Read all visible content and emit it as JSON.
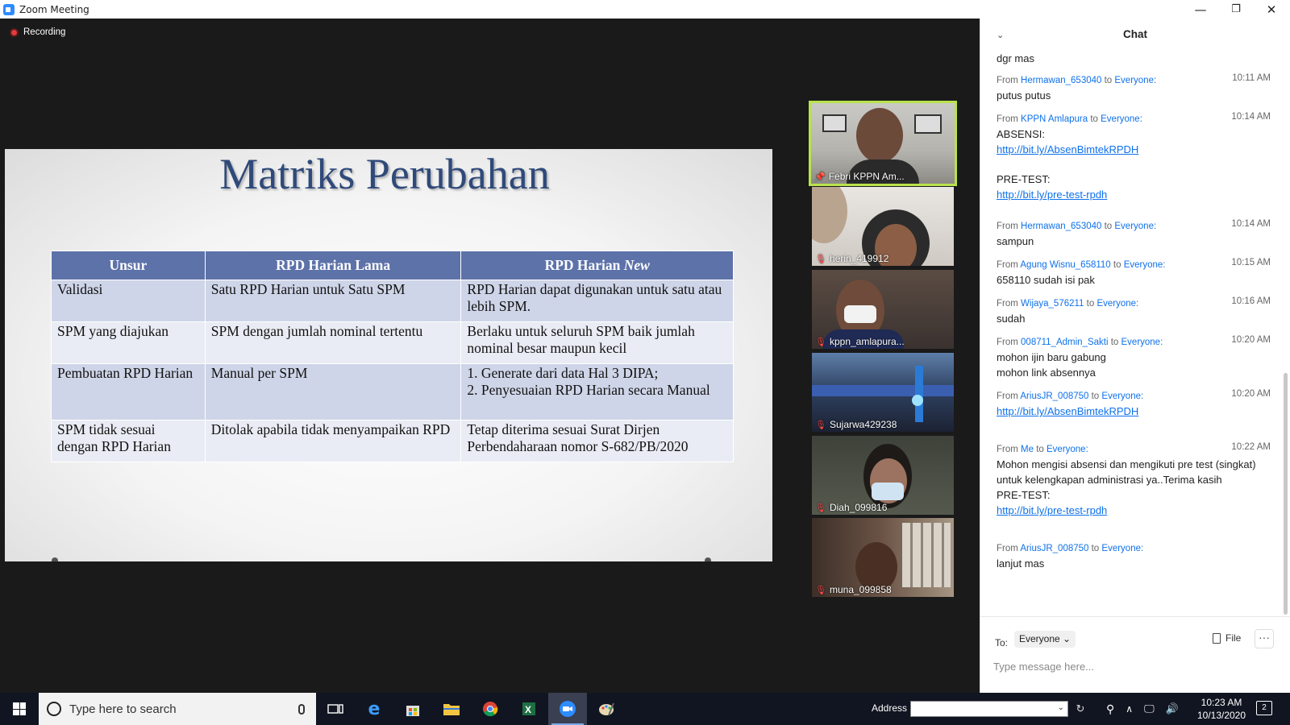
{
  "window": {
    "title": "Zoom Meeting",
    "minimize": "—",
    "maximize": "❐",
    "close": "✕"
  },
  "meeting": {
    "recording_label": "Recording"
  },
  "slide": {
    "title": "Matriks Perubahan",
    "headers": [
      "Unsur",
      "RPD Harian Lama",
      "RPD Harian ",
      "New"
    ],
    "rows": [
      [
        "Validasi",
        "Satu RPD Harian untuk Satu SPM",
        "RPD Harian dapat digunakan untuk satu atau lebih SPM."
      ],
      [
        "SPM yang diajukan",
        "SPM dengan jumlah nominal tertentu",
        "Berlaku untuk seluruh SPM baik jumlah nominal besar maupun kecil"
      ],
      [
        "Pembuatan RPD Harian",
        "Manual per SPM",
        "1. Generate dari data Hal 3 DIPA;",
        "2. Penyesuaian RPD Harian secara Manual"
      ],
      [
        "SPM tidak sesuai dengan RPD Harian",
        "Ditolak apabila tidak menyampaikan RPD",
        "Tetap diterima sesuai Surat Dirjen Perbendaharaan nomor S-682/PB/2020"
      ]
    ]
  },
  "participants": [
    {
      "name": "Febri KPPN Am...",
      "status": "pinned"
    },
    {
      "name": "herin_419912",
      "status": "muted"
    },
    {
      "name": "kppn_amlapura...",
      "status": "muted"
    },
    {
      "name": "Sujarwa429238",
      "status": "muted"
    },
    {
      "name": "Diah_099816",
      "status": "muted"
    },
    {
      "name": "muna_099858",
      "status": "muted"
    }
  ],
  "chat": {
    "header": "Chat",
    "top_fragment": "dgr mas",
    "from_word": "From ",
    "to_word": " to ",
    "messages": [
      {
        "from": "Hermawan_653040",
        "to": "Everyone:",
        "time": "10:11 AM",
        "lines": [
          "putus putus"
        ]
      },
      {
        "from": "KPPN Amlapura",
        "to": "Everyone:",
        "time": "10:14 AM",
        "lines": [
          "ABSENSI:"
        ],
        "link1": "http://bit.ly/AbsenBimtekRPDH",
        "line2": "PRE-TEST:",
        "link2": "http://bit.ly/pre-test-rpdh"
      },
      {
        "from": "Hermawan_653040",
        "to": "Everyone:",
        "time": "10:14 AM",
        "lines": [
          "sampun"
        ]
      },
      {
        "from": "Agung Wisnu_658110",
        "to": "Everyone:",
        "time": "10:15 AM",
        "lines": [
          "658110 sudah isi pak"
        ]
      },
      {
        "from": "Wijaya_576211",
        "to": "Everyone:",
        "time": "10:16 AM",
        "lines": [
          "sudah"
        ]
      },
      {
        "from": "008711_Admin_Sakti",
        "to": "Everyone:",
        "time": "10:20 AM",
        "lines": [
          "mohon ijin baru gabung",
          "mohon link absennya"
        ]
      },
      {
        "from": "AriusJR_008750",
        "to": "Everyone:",
        "time": "10:20 AM",
        "link1": "http://bit.ly/AbsenBimtekRPDH"
      },
      {
        "from": "Me",
        "to": "Everyone:",
        "time": "10:22 AM",
        "lines": [
          "Mohon mengisi absensi dan mengikuti pre test (singkat) untuk kelengkapan administrasi ya..Terima kasih",
          "PRE-TEST:"
        ],
        "link1": "http://bit.ly/pre-test-rpdh"
      },
      {
        "from": "AriusJR_008750",
        "to": "Everyone:",
        "time": "",
        "lines": [
          "lanjut mas"
        ]
      }
    ],
    "to_label": "To:",
    "to_value": "Everyone ⌄",
    "file_label": "File",
    "more_label": "···",
    "input_placeholder": "Type message here..."
  },
  "taskbar": {
    "search_placeholder": "Type here to search",
    "address_label": "Address",
    "time": "10:23 AM",
    "date": "10/13/2020",
    "notification_count": "2"
  }
}
